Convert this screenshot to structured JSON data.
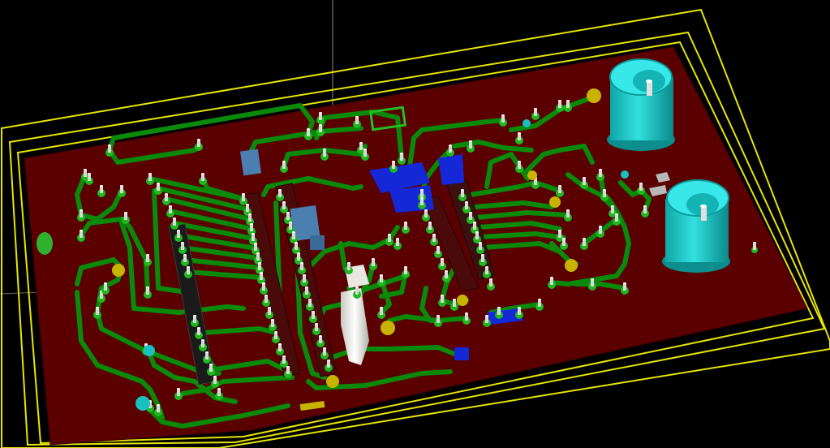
{
  "scene": {
    "kind": "3d-pcb-view",
    "background_color": "#000000",
    "board_color": "#5a0000",
    "trace_color": "#0a8a0a",
    "pad_color": "#1fb81f",
    "pin_color": "#d8d8d8",
    "component_blue": "#1428d8",
    "component_steel": "#4a7fb0",
    "connector_color": "#16c6c6",
    "outline_color": "#e6e600",
    "cursor_line_color": "#9a9a9a"
  }
}
